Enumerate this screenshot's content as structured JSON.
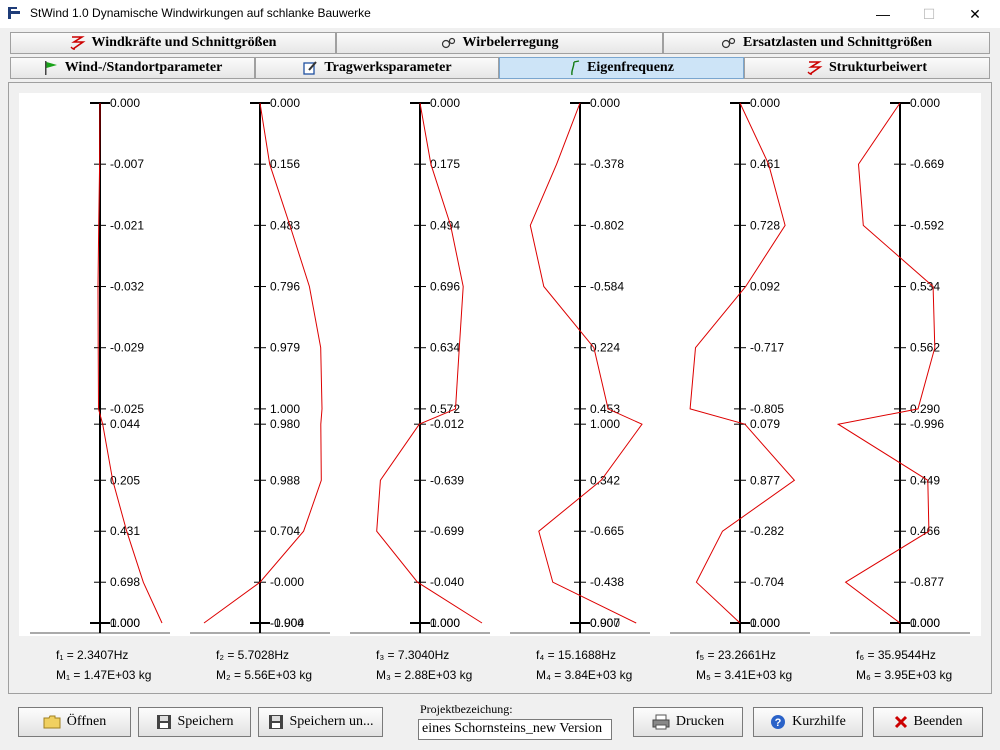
{
  "window": {
    "title": "StWind 1.0   Dynamische Windwirkungen auf schlanke Bauwerke"
  },
  "tabs": [
    {
      "label": "Windkräfte und Schnittgrößen",
      "icon": "windforce-icon",
      "active": false
    },
    {
      "label": "Wirbelerregung",
      "icon": "vortex-icon",
      "active": false
    },
    {
      "label": "Ersatzlasten und Schnittgrößen",
      "icon": "vortex-icon",
      "active": false
    },
    {
      "label": "Wind-/Standortparameter",
      "icon": "flag-icon",
      "active": false
    },
    {
      "label": "Tragwerksparameter",
      "icon": "edit-icon",
      "active": false
    },
    {
      "label": "Eigenfrequenz",
      "icon": "frequency-icon",
      "active": true
    },
    {
      "label": "Strukturbeiwert",
      "icon": "windforce-icon",
      "active": false
    }
  ],
  "colors": {
    "mode_line": "#dd0000",
    "axis": "#000000",
    "active_tab": "#cde4f7"
  },
  "chart_data": [
    {
      "type": "line",
      "orientation": "vertical-mode-shape",
      "levels": [
        1.0,
        0.88,
        0.76,
        0.64,
        0.52,
        0.4,
        0.37,
        0.26,
        0.16,
        0.06,
        -0.02
      ],
      "values": [
        0.0,
        -0.007,
        -0.021,
        -0.032,
        -0.029,
        -0.025,
        0.044,
        0.205,
        0.431,
        0.698,
        1.0
      ],
      "tick_labels": [
        "0.000",
        "-0.007",
        "-0.021",
        "-0.032",
        "-0.029",
        "-0.025",
        "0.044",
        "0.205",
        "0.431",
        "0.698",
        "1.000"
      ],
      "top_overlap_label": "0.000",
      "frequency": "f₁ = 2.3407Hz",
      "mass": "M₁ = 1.47E+03 kg"
    },
    {
      "type": "line",
      "orientation": "vertical-mode-shape",
      "levels": [
        1.0,
        0.88,
        0.76,
        0.64,
        0.52,
        0.4,
        0.37,
        0.26,
        0.16,
        0.06,
        -0.02
      ],
      "values": [
        0.0,
        0.156,
        0.483,
        0.796,
        0.979,
        1.0,
        0.98,
        0.988,
        0.704,
        0.0,
        -0.904
      ],
      "tick_labels": [
        "0.000",
        "0.156",
        "0.483",
        "0.796",
        "0.979",
        "1.000",
        "0.980",
        "0.988",
        "0.704",
        "-0.000",
        "-0.904"
      ],
      "top_overlap_label": "-1.000",
      "frequency": "f₂ = 5.7028Hz",
      "mass": "M₂ = 5.56E+03 kg"
    },
    {
      "type": "line",
      "orientation": "vertical-mode-shape",
      "levels": [
        1.0,
        0.88,
        0.76,
        0.64,
        0.52,
        0.4,
        0.37,
        0.26,
        0.16,
        0.06,
        -0.02
      ],
      "values": [
        0.0,
        0.175,
        0.494,
        0.696,
        0.634,
        0.572,
        -0.012,
        -0.639,
        -0.699,
        -0.04,
        1.0
      ],
      "tick_labels": [
        "0.000",
        "0.175",
        "0.494",
        "0.696",
        "0.634",
        "0.572",
        "-0.012",
        "-0.639",
        "-0.699",
        "-0.040",
        "1.000"
      ],
      "top_overlap_label": "0.000",
      "frequency": "f₃ = 7.3040Hz",
      "mass": "M₃ = 2.88E+03 kg"
    },
    {
      "type": "line",
      "orientation": "vertical-mode-shape",
      "levels": [
        1.0,
        0.88,
        0.76,
        0.64,
        0.52,
        0.4,
        0.37,
        0.26,
        0.16,
        0.06,
        -0.02
      ],
      "values": [
        0.0,
        -0.378,
        -0.802,
        -0.584,
        0.224,
        0.453,
        1.0,
        0.342,
        -0.665,
        -0.438,
        0.907
      ],
      "tick_labels": [
        "0.000",
        "-0.378",
        "-0.802",
        "-0.584",
        "0.224",
        "0.453",
        "1.000",
        "0.342",
        "-0.665",
        "-0.438",
        "0.907"
      ],
      "top_overlap_label": "0.000",
      "frequency": "f₄ = 15.1688Hz",
      "mass": "M₄ = 3.84E+03 kg"
    },
    {
      "type": "line",
      "orientation": "vertical-mode-shape",
      "levels": [
        1.0,
        0.88,
        0.76,
        0.64,
        0.52,
        0.4,
        0.37,
        0.26,
        0.16,
        0.06,
        -0.02
      ],
      "values": [
        0.0,
        0.461,
        0.728,
        0.092,
        -0.717,
        -0.805,
        0.079,
        0.877,
        -0.282,
        -0.704,
        0.0
      ],
      "tick_labels": [
        "0.000",
        "0.461",
        "0.728",
        "0.092",
        "-0.717",
        "-0.805",
        "0.079",
        "0.877",
        "-0.282",
        "-0.704",
        "0.000"
      ],
      "top_overlap_label": "1.000",
      "frequency": "f₅ = 23.2661Hz",
      "mass": "M₅ = 3.41E+03 kg"
    },
    {
      "type": "line",
      "orientation": "vertical-mode-shape",
      "levels": [
        1.0,
        0.88,
        0.76,
        0.64,
        0.52,
        0.4,
        0.37,
        0.26,
        0.16,
        0.06,
        -0.02
      ],
      "values": [
        0.0,
        -0.669,
        -0.592,
        0.534,
        0.562,
        0.29,
        -0.996,
        0.449,
        0.466,
        -0.877,
        0.0
      ],
      "tick_labels": [
        "0.000",
        "-0.669",
        "-0.592",
        "0.534",
        "0.562",
        "0.290",
        "-0.996",
        "0.449",
        "0.466",
        "-0.877",
        "0.000"
      ],
      "top_overlap_label": "1.000",
      "frequency": "f₆ = 35.9544Hz",
      "mass": "M₆ = 3.95E+03 kg"
    }
  ],
  "bottom": {
    "open_label": "Öffnen",
    "save_label": "Speichern",
    "save_as_label": "Speichern un...",
    "project_label": "Projektbezeichung:",
    "project_value": "eines Schornsteins_new Version",
    "print_label": "Drucken",
    "help_label": "Kurzhilfe",
    "exit_label": "Beenden"
  }
}
